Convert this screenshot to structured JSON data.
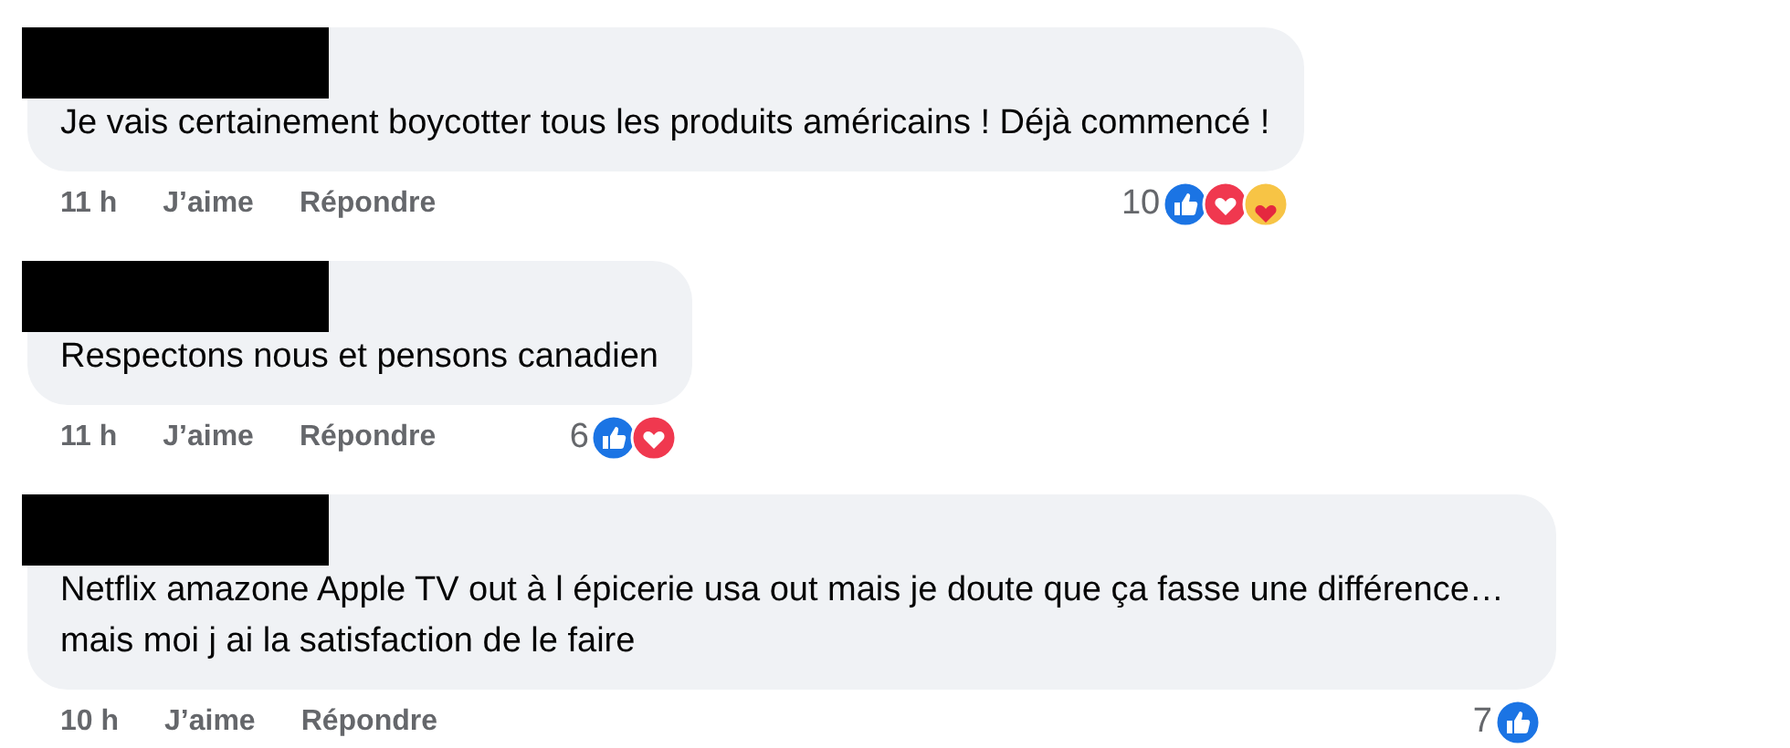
{
  "comments": [
    {
      "text": "Je vais certainement boycotter tous les produits américains ! Déjà commencé !",
      "time": "11 h",
      "like": "J’aime",
      "reply": "Répondre",
      "reaction_count": "10",
      "reactions": [
        {
          "kind": "like"
        },
        {
          "kind": "love"
        },
        {
          "kind": "care"
        }
      ]
    },
    {
      "text": "Respectons nous et pensons canadien",
      "time": "11 h",
      "like": "J’aime",
      "reply": "Répondre",
      "reaction_count": "6",
      "reactions": [
        {
          "kind": "like"
        },
        {
          "kind": "love"
        }
      ]
    },
    {
      "text": "Netflix amazone Apple TV out à l épicerie usa out mais je doute que ça fasse une différence… mais moi j ai la satisfaction de le faire",
      "time": "10 h",
      "like": "J’aime",
      "reply": "Répondre",
      "reaction_count": "7",
      "reactions": [
        {
          "kind": "like"
        }
      ]
    }
  ]
}
